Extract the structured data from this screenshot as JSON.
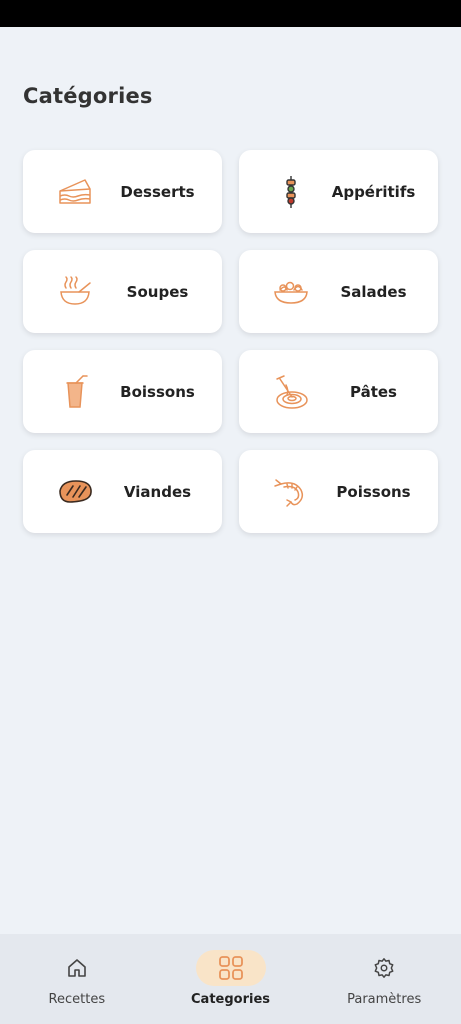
{
  "page": {
    "title": "Catégories"
  },
  "categories": [
    {
      "label": "Desserts",
      "icon": "cake-slice-icon"
    },
    {
      "label": "Appéritifs",
      "icon": "skewer-icon"
    },
    {
      "label": "Soupes",
      "icon": "soup-bowl-icon"
    },
    {
      "label": "Salades",
      "icon": "salad-bowl-icon"
    },
    {
      "label": "Boissons",
      "icon": "drink-glass-icon"
    },
    {
      "label": "Pâtes",
      "icon": "pasta-fork-icon"
    },
    {
      "label": "Viandes",
      "icon": "steak-icon"
    },
    {
      "label": "Poissons",
      "icon": "shrimp-icon"
    }
  ],
  "bottom_nav": {
    "items": [
      {
        "label": "Recettes",
        "icon": "home-icon",
        "active": false
      },
      {
        "label": "Categories",
        "icon": "grid-icon",
        "active": true
      },
      {
        "label": "Paramètres",
        "icon": "gear-icon",
        "active": false
      }
    ]
  },
  "colors": {
    "accent": "#e8935a",
    "background": "#eef2f7",
    "active_pill": "#f9e4c8"
  }
}
